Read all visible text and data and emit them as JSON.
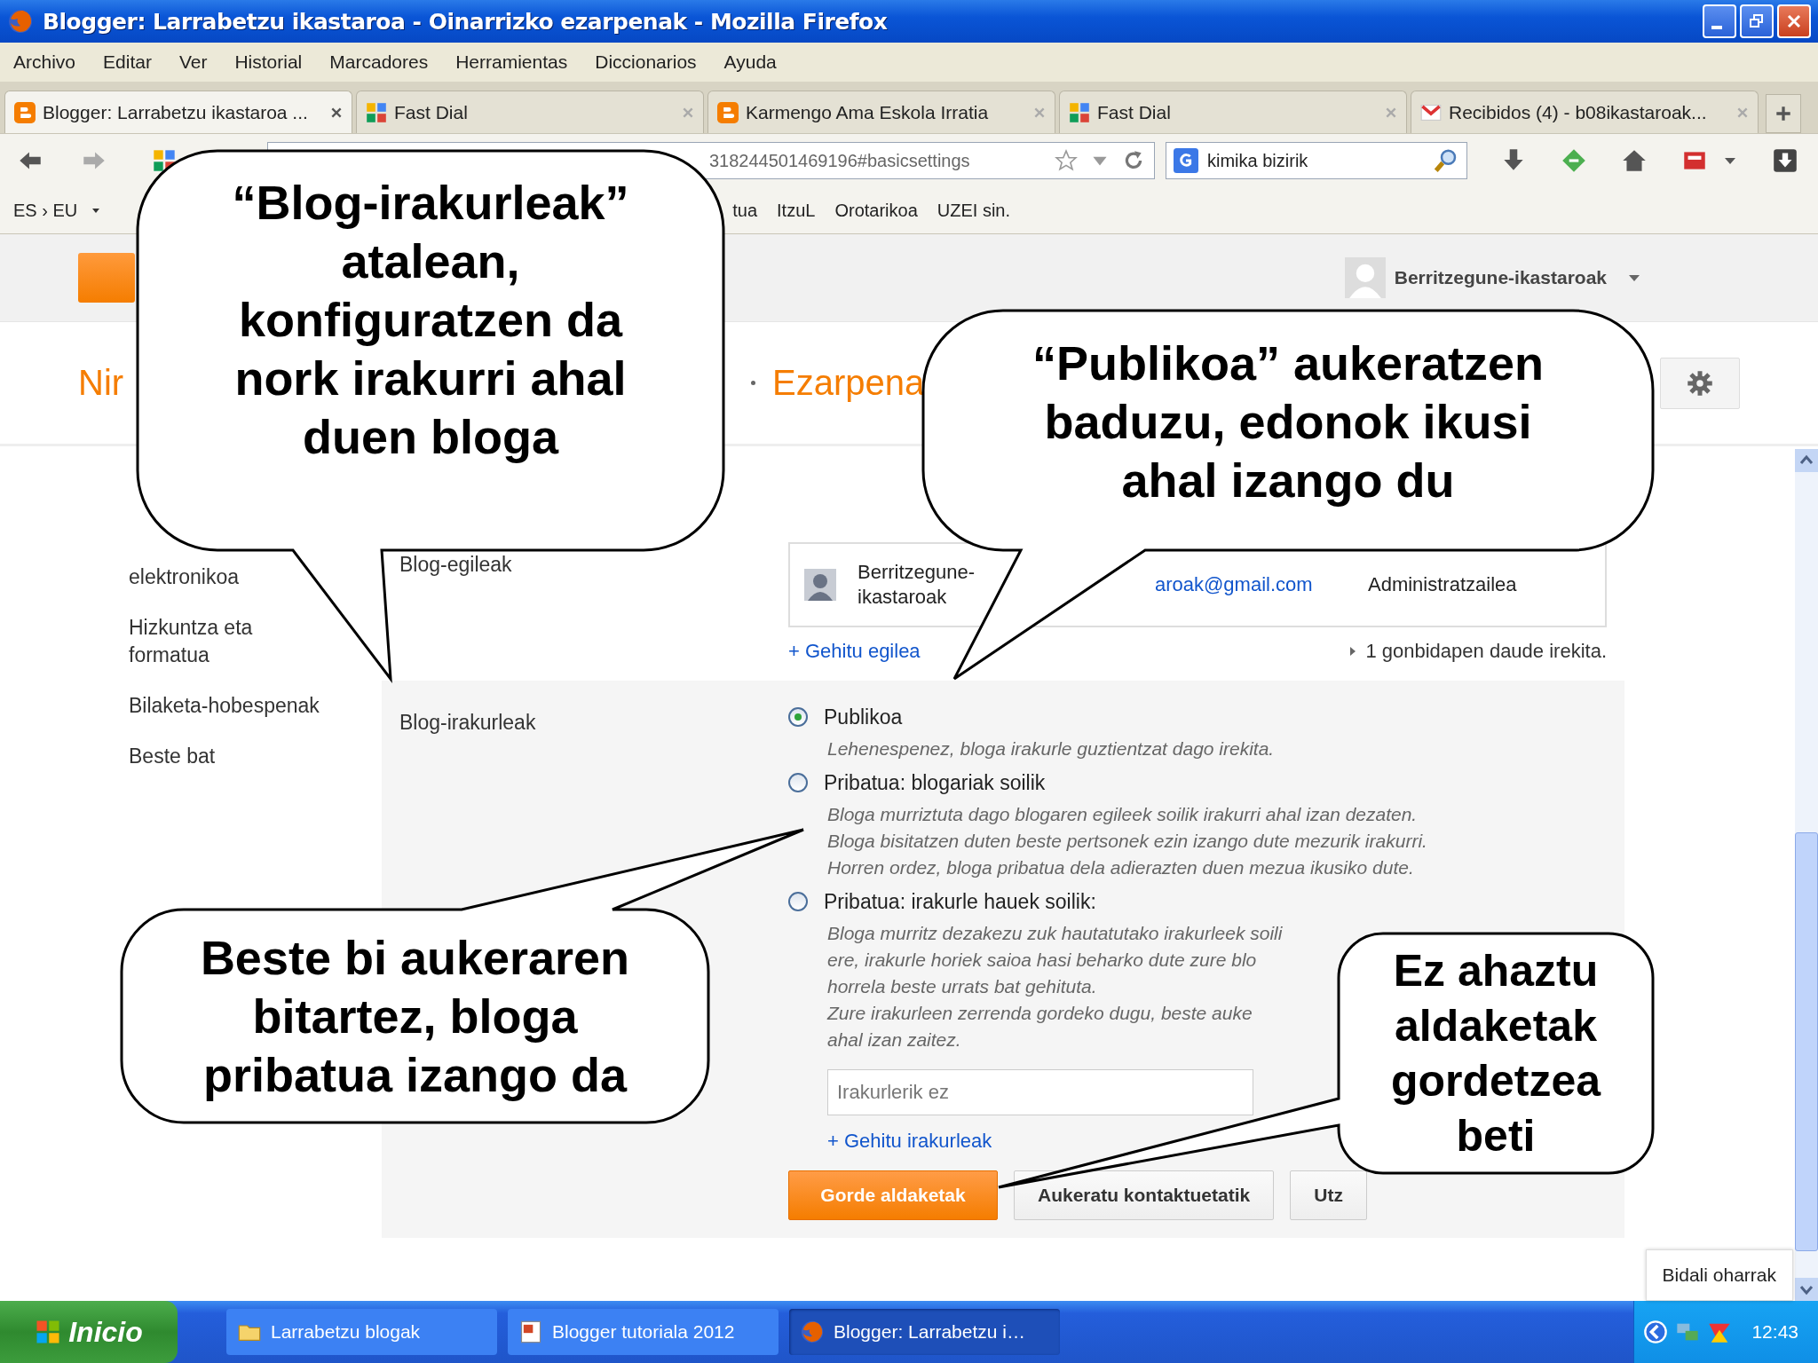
{
  "window": {
    "title": "Blogger: Larrabetzu ikastaroa - Oinarrizko ezarpenak - Mozilla Firefox"
  },
  "menu": [
    "Archivo",
    "Editar",
    "Ver",
    "Historial",
    "Marcadores",
    "Herramientas",
    "Diccionarios",
    "Ayuda"
  ],
  "tabs": [
    {
      "title": "Blogger: Larrabetzu ikastaroa ...",
      "kind": "blogger",
      "selected": true
    },
    {
      "title": "Fast Dial",
      "kind": "fastdial",
      "selected": false
    },
    {
      "title": "Karmengo Ama Eskola Irratia",
      "kind": "blogger",
      "selected": false
    },
    {
      "title": "Fast Dial",
      "kind": "fastdial",
      "selected": false
    },
    {
      "title": "Recibidos (4) - b08ikastaroak...",
      "kind": "gmail",
      "selected": false
    }
  ],
  "nav_toolbar": {
    "url": "318244501469196#basicsettings",
    "search": "kimika bizirik"
  },
  "bookmarks": {
    "language": "ES › EU",
    "items": [
      "tua",
      "ItzuL",
      "Orotarikoa",
      "UZEI sin."
    ]
  },
  "blogger_header": {
    "user": "Berritzegune-ikastaroak"
  },
  "page_nav": [
    "Nir",
    "Ezarpena"
  ],
  "sidebar": [
    "elektronikoa",
    "Hizkuntza eta formatua",
    "Bilaketa-hobespenak",
    "Beste bat"
  ],
  "authors": {
    "label": "Blog-egileak",
    "rows": [
      {
        "name": "Berritzegune-ikastaroak",
        "email": "aroak@gmail.com",
        "role": "Administratzailea"
      }
    ],
    "add_link": "+ Gehitu egilea",
    "invites": "1 gonbidapen daude irekita."
  },
  "readers": {
    "label": "Blog-irakurleak",
    "options": [
      {
        "label": "Publikoa",
        "selected": true,
        "description": [
          "Lehenespenez, bloga irakurle guztientzat dago irekita."
        ]
      },
      {
        "label": "Pribatua: blogariak soilik",
        "selected": false,
        "description": [
          "Bloga murriztuta dago blogaren egileek soilik irakurri ahal izan dezaten.",
          "Bloga bisitatzen duten beste pertsonek ezin izango dute mezurik irakurri.",
          "Horren ordez, bloga pribatua dela adierazten duen mezua ikusiko dute."
        ]
      },
      {
        "label": "Pribatua: irakurle hauek soilik:",
        "selected": false,
        "description": [
          "Bloga murritz dezakezu zuk hautatutako irakurleek soili",
          "ere, irakurle horiek saioa hasi beharko dute zure blo",
          "horrela beste urrats bat gehituta.",
          "Zure irakurleen zerrenda gordeko dugu, beste auke",
          "ahal izan zaitez."
        ]
      }
    ],
    "input": {
      "placeholder": "Irakurlerik ez"
    },
    "add_link": "+ Gehitu irakurleak",
    "buttons": [
      {
        "label": "Gorde aldaketak",
        "kind": "primary"
      },
      {
        "label": "Aukeratu kontaktuetatik",
        "kind": "default"
      },
      {
        "label": "Utz",
        "kind": "default"
      }
    ]
  },
  "feedback": "Bidali oharrak",
  "callouts": [
    {
      "text": "“Blog-irakurleak”\natalean,\nkonfiguratzen da\nnork irakurri ahal\nduen bloga"
    },
    {
      "text": "“Publikoa” aukeratzen\nbaduzu, edonok ikusi\nahal izango du"
    },
    {
      "text": "Beste bi aukeraren\nbitartez, bloga\npribatua izango da"
    },
    {
      "text": "Ez ahaztu\naldaketak\ngordetzea\nbeti"
    }
  ],
  "taskbar": {
    "start": "Inicio",
    "tasks": [
      {
        "label": "Larrabetzu blogak",
        "kind": "folder",
        "selected": false
      },
      {
        "label": "Blogger tutoriala 2012",
        "kind": "document",
        "selected": false
      },
      {
        "label": "Blogger: Larrabetzu i…",
        "kind": "firefox",
        "selected": true
      }
    ],
    "clock": "12:43"
  }
}
